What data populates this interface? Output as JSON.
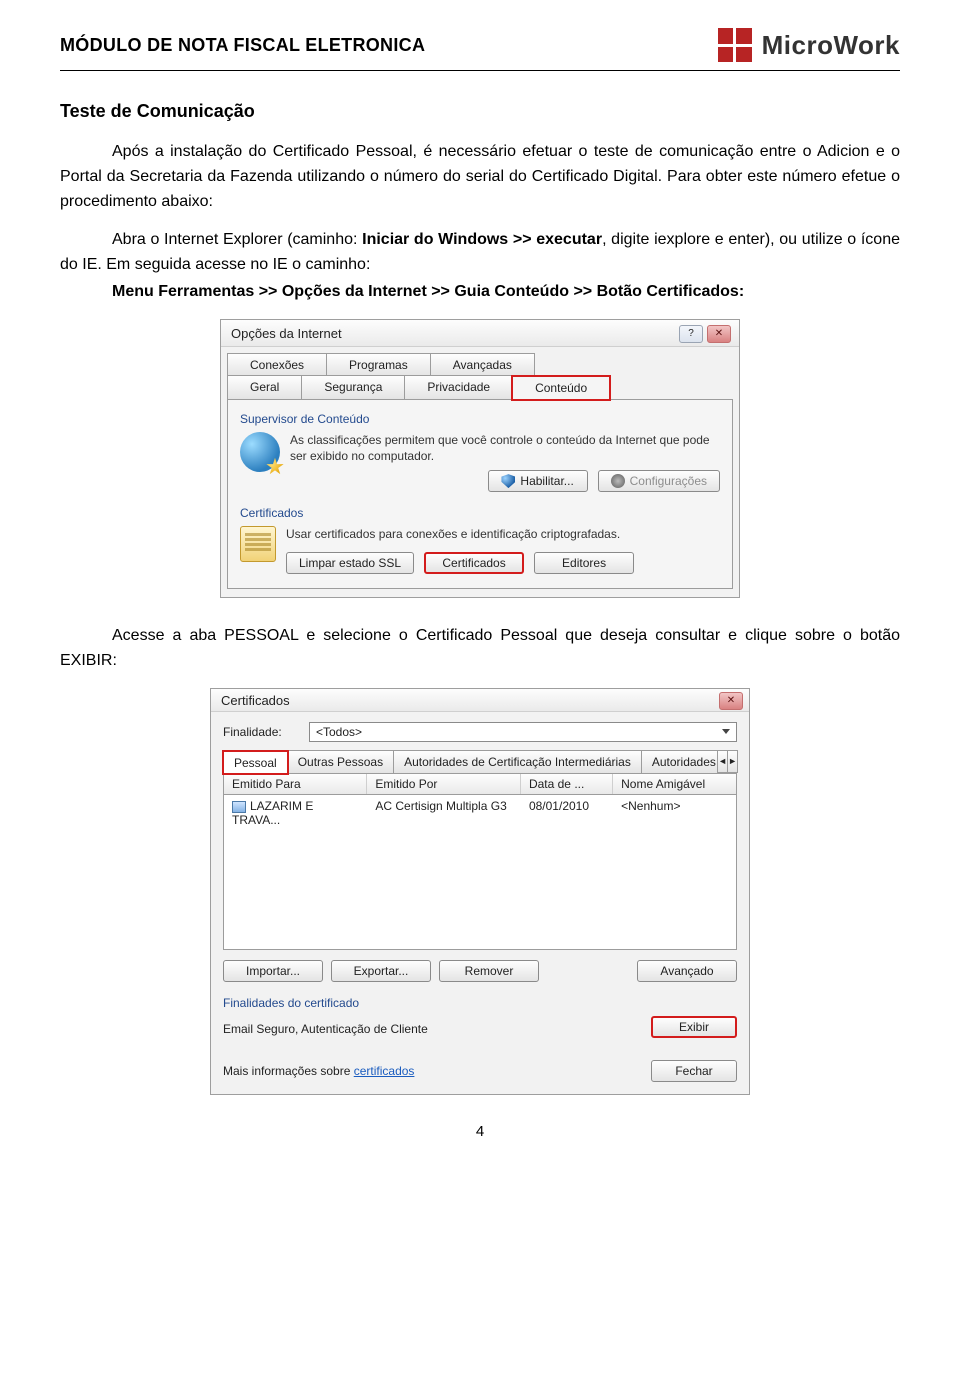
{
  "header": {
    "module_title": "MÓDULO DE  NOTA FISCAL ELETRONICA",
    "brand": "MicroWork"
  },
  "doc": {
    "section_title": "Teste de Comunicação",
    "para1": "Após a instalação do Certificado Pessoal, é necessário efetuar o teste de comunicação entre o Adicion e o Portal da Secretaria da Fazenda utilizando o número do serial do Certificado Digital. Para obter este número efetue o procedimento abaixo:",
    "para2a": "Abra o Internet Explorer (caminho: ",
    "para2b": "Iniciar do Windows >> executar",
    "para2c": ", digite iexplore e enter), ou utilize o ícone do IE. Em seguida acesse no IE o caminho:",
    "bold_path": "Menu Ferramentas >> Opções da Internet >> Guia Conteúdo >> Botão Certificados:",
    "para3": "Acesse a aba PESSOAL e selecione o Certificado Pessoal que deseja consultar e clique sobre o botão EXIBIR:"
  },
  "dlg1": {
    "title": "Opções da Internet",
    "tabs_top": [
      "Conexões",
      "Programas",
      "Avançadas"
    ],
    "tabs_bottom": [
      "Geral",
      "Segurança",
      "Privacidade",
      "Conteúdo"
    ],
    "group1_title": "Supervisor de Conteúdo",
    "group1_text": "As classificações permitem que você controle o conteúdo da Internet que pode ser exibido no computador.",
    "btn_habilitar": "Habilitar...",
    "btn_config": "Configurações",
    "group2_title": "Certificados",
    "group2_text": "Usar certificados para conexões e identificação criptografadas.",
    "btn_limpar": "Limpar estado SSL",
    "btn_certificados": "Certificados",
    "btn_editores": "Editores"
  },
  "dlg2": {
    "title": "Certificados",
    "field_label": "Finalidade:",
    "field_value": "<Todos>",
    "tabs": [
      "Pessoal",
      "Outras Pessoas",
      "Autoridades de Certificação Intermediárias",
      "Autoridades de Ce"
    ],
    "cols": [
      "Emitido Para",
      "Emitido Por",
      "Data de ...",
      "Nome Amigável"
    ],
    "row": {
      "a": "LAZARIM E TRAVA...",
      "b": "AC Certisign Multipla G3",
      "c": "08/01/2010",
      "d": "<Nenhum>"
    },
    "btn_importar": "Importar...",
    "btn_exportar": "Exportar...",
    "btn_remover": "Remover",
    "btn_avancado": "Avançado",
    "sub1": "Finalidades do certificado",
    "sub1_text": "Email Seguro, Autenticação de Cliente",
    "btn_exibir": "Exibir",
    "more_label": "Mais informações sobre ",
    "more_link": "certificados",
    "btn_fechar": "Fechar"
  },
  "page_number": "4"
}
